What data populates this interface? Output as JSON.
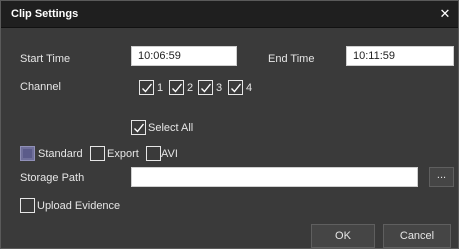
{
  "dialog": {
    "title": "Clip Settings",
    "close_glyph": "✕",
    "close_icon": "close-icon"
  },
  "time": {
    "start_label": "Start Time",
    "start_value": "10:06:59",
    "end_label": "End Time",
    "end_value": "10:11:59"
  },
  "channel": {
    "label": "Channel",
    "items": [
      {
        "label": "1",
        "checked": true
      },
      {
        "label": "2",
        "checked": true
      },
      {
        "label": "3",
        "checked": true
      },
      {
        "label": "4",
        "checked": true
      }
    ],
    "select_all_label": "Select All",
    "select_all_checked": true
  },
  "format": {
    "standard_label": "Standard",
    "export_label": "Export",
    "avi_label": "AVI"
  },
  "storage": {
    "label": "Storage Path",
    "value": "",
    "browse_label": "..."
  },
  "upload": {
    "label": "Upload Evidence",
    "checked": false
  },
  "buttons": {
    "ok_label": "OK",
    "cancel_label": "Cancel"
  },
  "colors": {
    "titlebar": "#1f1f1f",
    "body": "#3a3a3a",
    "text": "#e6e6e6",
    "standard_fill": "#6f6f9a"
  }
}
